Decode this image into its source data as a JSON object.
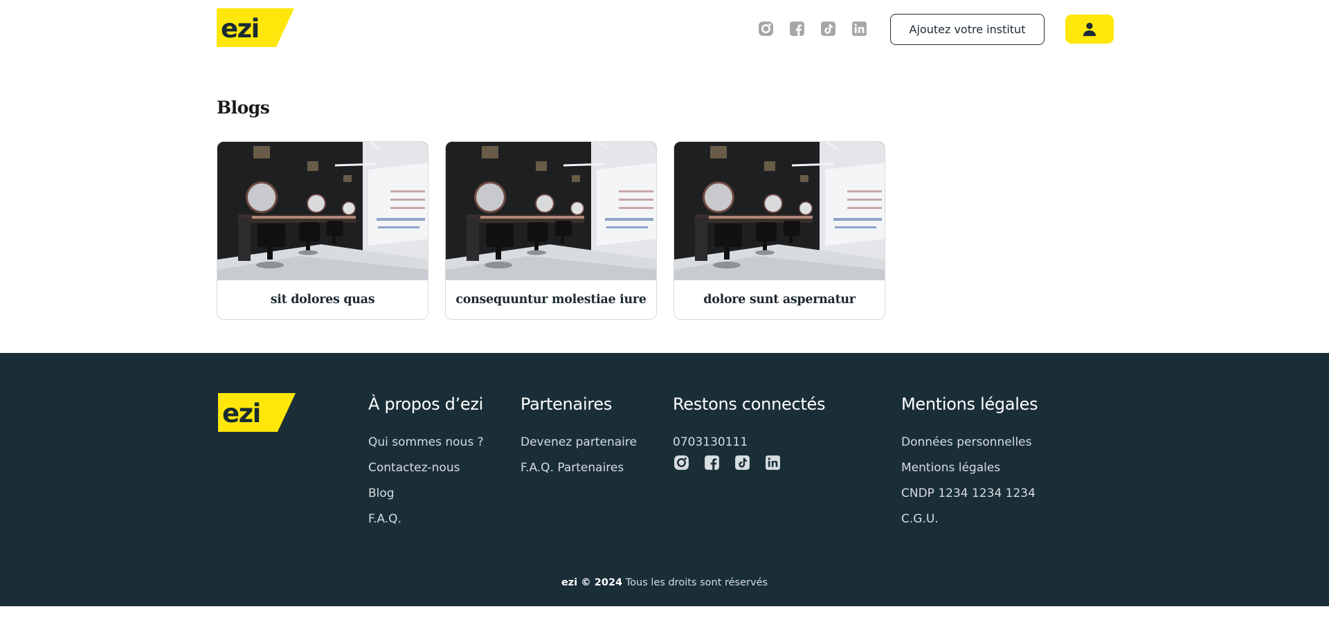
{
  "header": {
    "logo_text": "ezi",
    "social_icons": [
      "instagram-icon",
      "facebook-icon",
      "tiktok-icon",
      "linkedin-icon"
    ],
    "cta_label": "Ajoutez votre institut",
    "user_icon": "user-icon"
  },
  "blogs": {
    "title": "Blogs",
    "cards": [
      {
        "title": "sit dolores quas"
      },
      {
        "title": "consequuntur molestiae iure"
      },
      {
        "title": "dolore sunt aspernatur"
      }
    ]
  },
  "footer": {
    "logo_text": "ezi",
    "about": {
      "heading": "À propos d’ezi",
      "links": [
        "Qui sommes nous ?",
        "Contactez-nous",
        "Blog",
        "F.A.Q."
      ]
    },
    "partners": {
      "heading": "Partenaires",
      "links": [
        "Devenez partenaire",
        "F.A.Q. Partenaires"
      ]
    },
    "connect": {
      "heading": "Restons connectés",
      "phone": "0703130111"
    },
    "legal": {
      "heading": "Mentions légales",
      "links": [
        "Données personnelles",
        "Mentions légales",
        "CNDP 1234 1234 1234",
        "C.G.U."
      ]
    },
    "copyright_brand": "ezi © 2024",
    "copyright_text": "Tous les droits sont réservés"
  },
  "colors": {
    "brand_yellow": "#ffe70b",
    "footer_bg": "#1a2e38",
    "text_dark": "#1a2b33"
  }
}
